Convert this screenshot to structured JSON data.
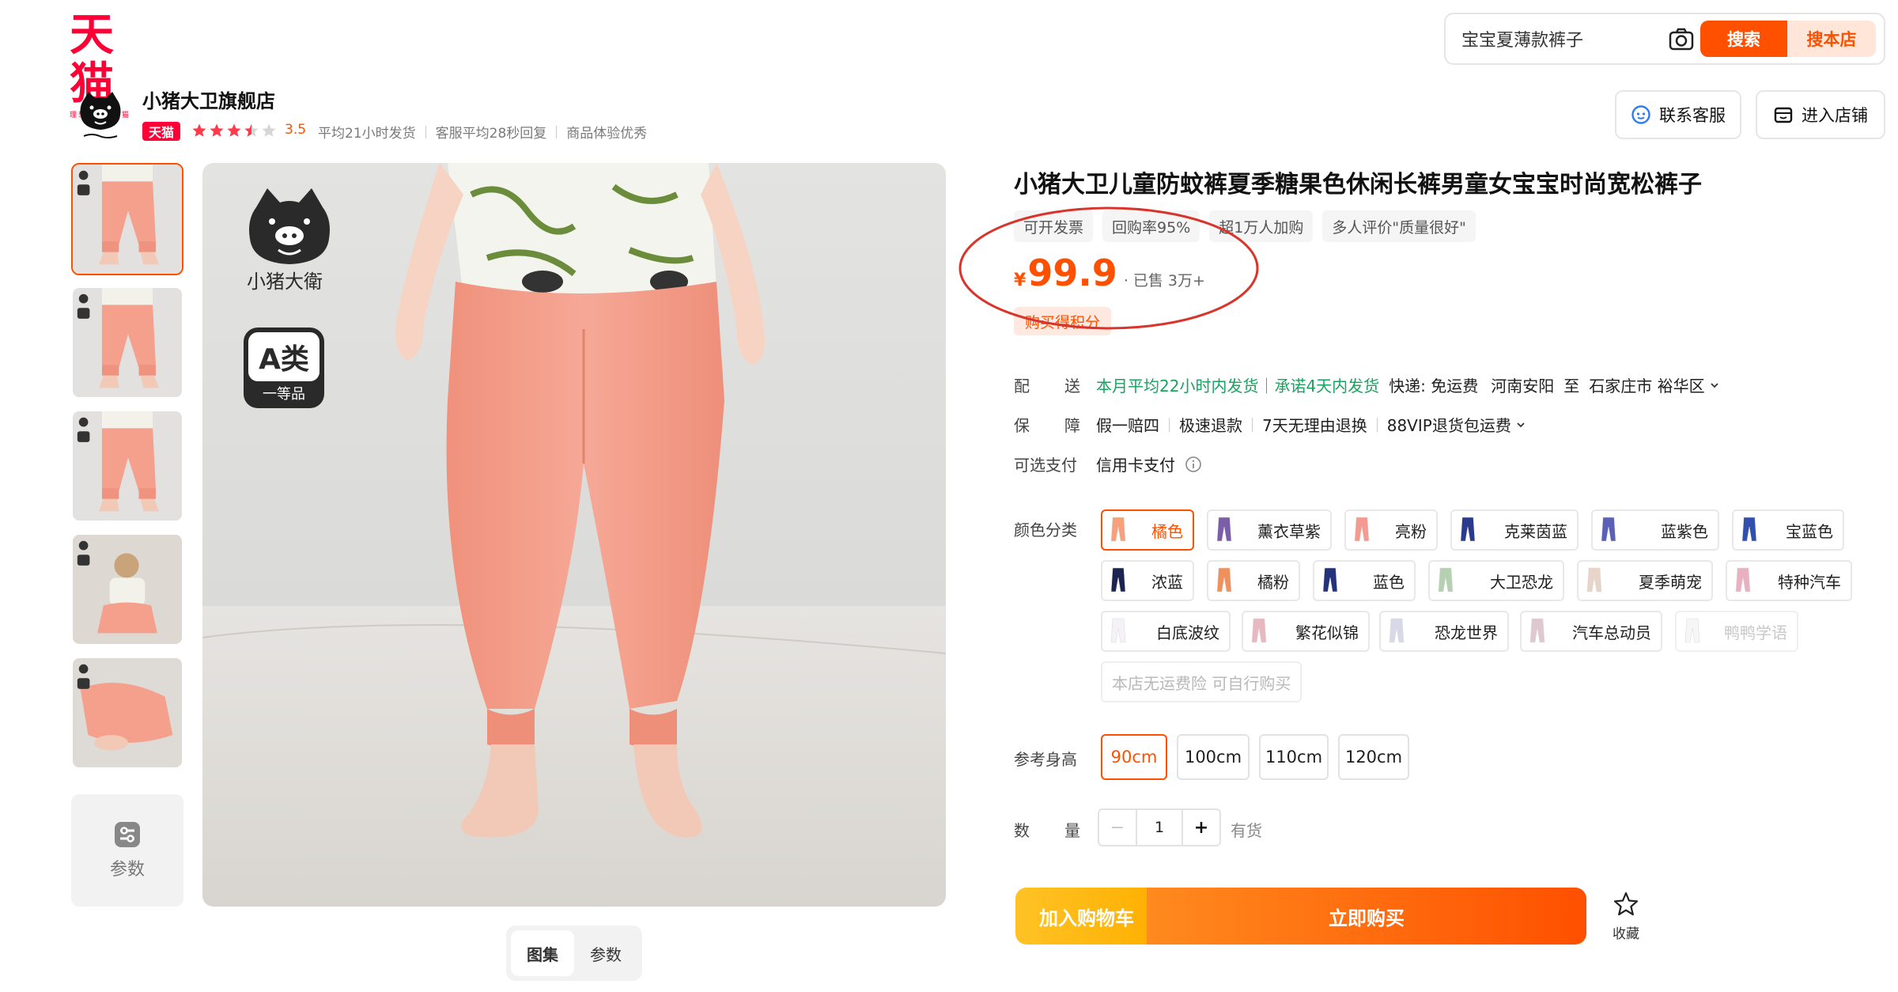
{
  "brand": {
    "logo_text": "天猫",
    "logo_tagline": "理想生活上天猫"
  },
  "search": {
    "value": "宝宝夏薄款裤子",
    "search_label": "搜索",
    "store_search_label": "搜本店"
  },
  "store": {
    "name": "小猪大卫旗舰店",
    "badge": "天猫",
    "rating": "3.5",
    "rating_stars": 3.5,
    "stats": [
      "平均21小时发货",
      "客服平均28秒回复",
      "商品体验优秀"
    ],
    "contact_label": "联系客服",
    "enter_store_label": "进入店铺"
  },
  "gallery": {
    "thumb_count": 5,
    "params_label": "参数",
    "tabs": [
      "图集",
      "参数"
    ],
    "main_logo_text": "小猪大衛",
    "grade_label": "A类",
    "grade_sub": "一等品"
  },
  "product": {
    "title": "小猪大卫儿童防蚊裤夏季糖果色休闲长裤男童女宝宝时尚宽松裤子",
    "tags": [
      "可开发票",
      "回购率95%",
      "超1万人加购",
      "多人评价\"质量很好\""
    ],
    "price_symbol": "¥",
    "price": "99.9",
    "sold": "· 已售 3万+",
    "points_badge": "购买得积分"
  },
  "shipping": {
    "label_chars": [
      "配",
      "送"
    ],
    "promise": "本月平均22小时内发货｜承诺4天内发货",
    "express": "快递: 免运费",
    "origin": "河南安阳",
    "to": "至",
    "destination": "石家庄市 裕华区"
  },
  "guarantee": {
    "label_chars": [
      "保",
      "障"
    ],
    "items": [
      "假一赔四",
      "极速退款",
      "7天无理由退换",
      "88VIP退货包运费"
    ]
  },
  "payment": {
    "label": "可选支付",
    "value": "信用卡支付"
  },
  "colors": {
    "label": "颜色分类",
    "options": [
      "橘色",
      "薰衣草紫",
      "亮粉",
      "克莱茵蓝",
      "蓝紫色",
      "宝蓝色",
      "浓蓝",
      "橘粉",
      "蓝色",
      "大卫恐龙",
      "夏季萌宠",
      "特种汽车",
      "白底波纹",
      "繁花似锦",
      "恐龙世界",
      "汽车总动员",
      "鸭鸭学语"
    ],
    "swatch_colors": [
      "#f7a07c",
      "#7a5fa8",
      "#f59a90",
      "#2a3a8c",
      "#5a5fb8",
      "#3050b0",
      "#1c2450",
      "#f0905a",
      "#23327a",
      "#b4d0b0",
      "#e8d4c8",
      "#e8b0c0",
      "#f4f2f6",
      "#e8b8c0",
      "#d8d8e8",
      "#e0c8d0",
      "#f6f6f6"
    ],
    "selected": "橘色",
    "disabled": "鸭鸭学语",
    "note": "本店无运费险 可自行购买"
  },
  "sizes": {
    "label": "参考身高",
    "options": [
      "90cm",
      "100cm",
      "110cm",
      "120cm"
    ],
    "selected": "90cm"
  },
  "quantity": {
    "label_chars": [
      "数",
      "量"
    ],
    "value": "1",
    "minus": "−",
    "plus": "+",
    "stock": "有货"
  },
  "actions": {
    "add_to_cart": "加入购物车",
    "buy_now": "立即购买",
    "favorite": "收藏"
  },
  "theme": {
    "accent": "#ff5000",
    "brand_red": "#ff0036",
    "annotation_red": "#d9342b",
    "pants_pink": "#f4a08c"
  }
}
